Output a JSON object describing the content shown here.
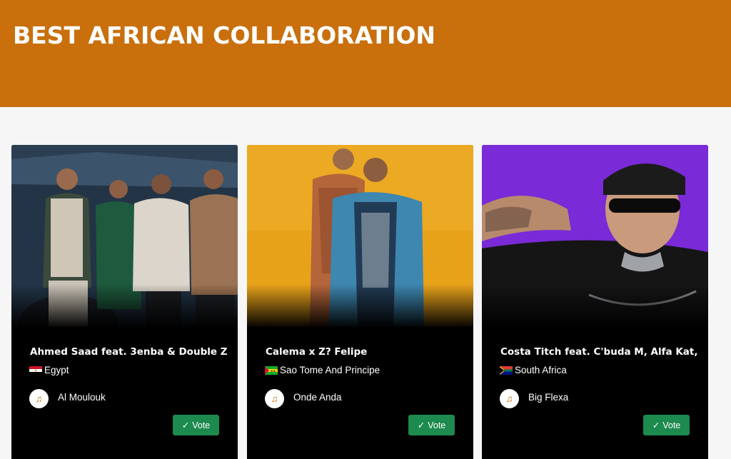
{
  "header": {
    "title": "BEST AFRICAN COLLABORATION",
    "color": "#c9700d"
  },
  "vote_color": "#1d8a4e",
  "nominees": [
    {
      "title": "Ahmed Saad feat. 3enba & Double Z",
      "country": "Egypt",
      "flag_icon": "egypt-flag-icon",
      "song": "Al Moulouk",
      "vote_label": "Vote"
    },
    {
      "title": "Calema x Z? Felipe",
      "country": "Sao Tome And Principe",
      "flag_icon": "sao-tome-flag-icon",
      "song": "Onde Anda",
      "vote_label": "Vote"
    },
    {
      "title": "Costa Titch feat. C'buda M, Alfa Kat,",
      "country": "South Africa",
      "flag_icon": "south-africa-flag-icon",
      "song": "Big Flexa",
      "vote_label": "Vote"
    }
  ]
}
